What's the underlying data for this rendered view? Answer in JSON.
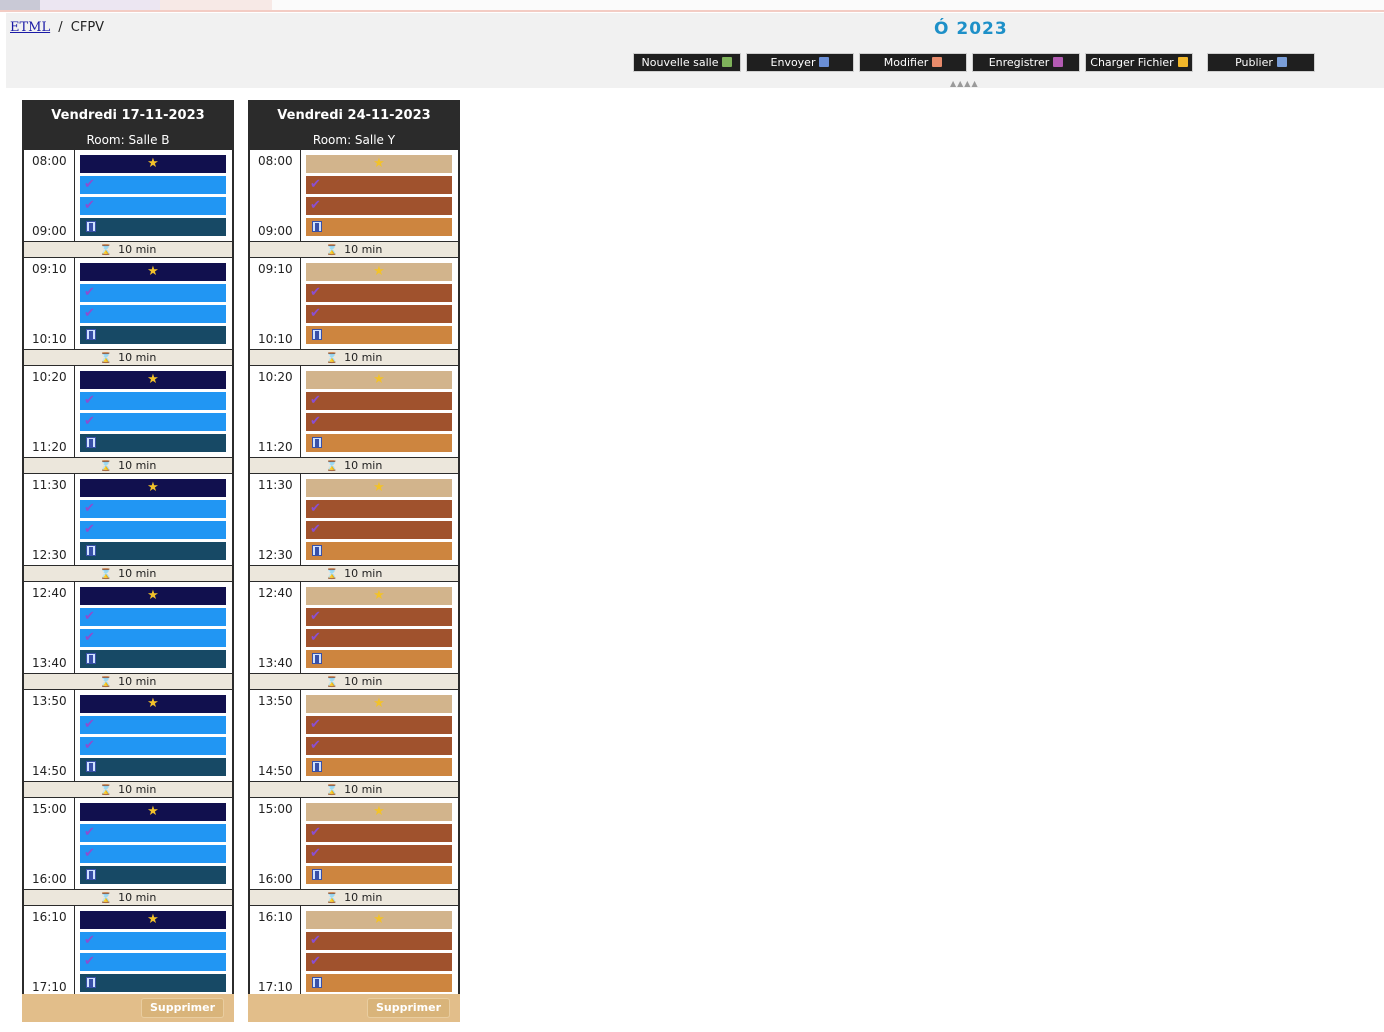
{
  "breadcrumb": {
    "root": "ETML",
    "separator": "/",
    "current": "CFPV"
  },
  "header": {
    "year_title": "Ó 2023"
  },
  "toolbar": {
    "buttons": [
      {
        "label": "Nouvelle salle",
        "icon": "add-room-icon",
        "color": "#7fb35b"
      },
      {
        "label": "Envoyer",
        "icon": "send-icon",
        "color": "#6b8fd6"
      },
      {
        "label": "Modifier",
        "icon": "edit-icon",
        "color": "#e88b6b"
      },
      {
        "label": "Enregistrer",
        "icon": "save-icon",
        "color": "#b35bb3"
      },
      {
        "label": "Charger Fichier",
        "icon": "folder-icon",
        "color": "#f2b72a"
      },
      {
        "label": "Publier",
        "icon": "calendar-icon",
        "color": "#7a9ed8"
      }
    ],
    "collapse_label": "▲▲▲▲"
  },
  "days": [
    {
      "title": "Vendredi 17-11-2023",
      "room": "Room: Salle B",
      "colors": {
        "star_bar": "#11104e",
        "check_bar": "#2196f3",
        "door_bar": "#174965"
      },
      "delete_label": "Supprimer"
    },
    {
      "title": "Vendredi 24-11-2023",
      "room": "Room: Salle Y",
      "colors": {
        "star_bar": "#d2b48c",
        "check_bar": "#a0522d",
        "door_bar": "#cd853f"
      },
      "delete_label": "Supprimer"
    }
  ],
  "slots": [
    {
      "start": "08:00",
      "end": "09:00"
    },
    {
      "start": "09:10",
      "end": "10:10"
    },
    {
      "start": "10:20",
      "end": "11:20"
    },
    {
      "start": "11:30",
      "end": "12:30"
    },
    {
      "start": "12:40",
      "end": "13:40"
    },
    {
      "start": "13:50",
      "end": "14:50"
    },
    {
      "start": "15:00",
      "end": "16:00"
    },
    {
      "start": "16:10",
      "end": "17:10"
    }
  ],
  "pause_label": "10 min"
}
